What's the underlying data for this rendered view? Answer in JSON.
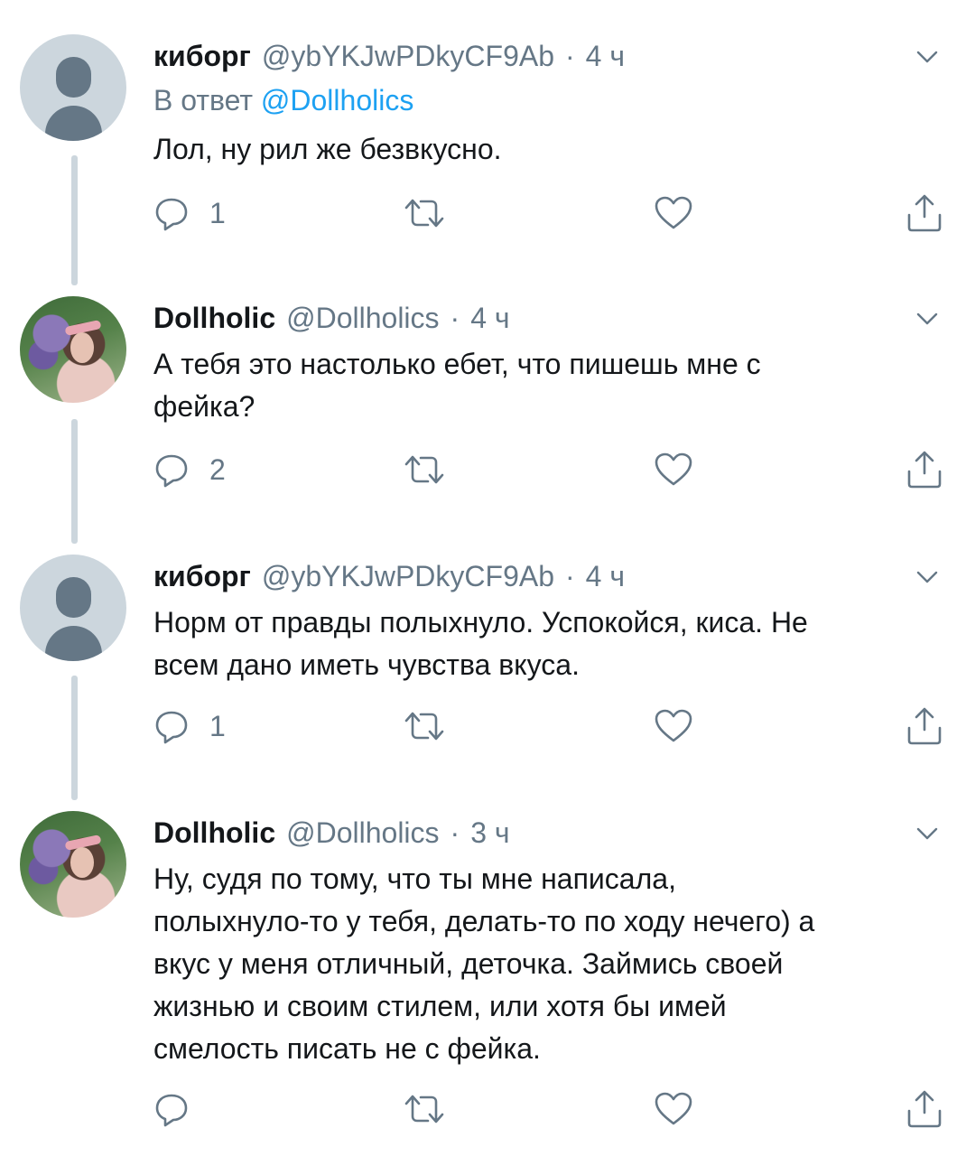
{
  "colors": {
    "accent": "#1da1f2",
    "text": "#14171a",
    "muted": "#657786",
    "thread_line": "#ccd6dd"
  },
  "tweets": [
    {
      "name": "киборг",
      "handle": "@ybYKJwPDkyCF9Ab",
      "dot": "·",
      "time": "4 ч",
      "reply_prefix": "В ответ",
      "reply_mention": "@Dollholics",
      "lines": [
        "Лол, ну рил же безвкусно."
      ],
      "reply_count": "1",
      "avatar": "default-avatar-icon"
    },
    {
      "name": "Dollholic",
      "handle": "@Dollholics",
      "dot": "·",
      "time": "4 ч",
      "lines": [
        "А тебя это настолько ебет, что пишешь мне с",
        "фейка?"
      ],
      "reply_count": "2",
      "avatar": "profile-photo"
    },
    {
      "name": "киборг",
      "handle": "@ybYKJwPDkyCF9Ab",
      "dot": "·",
      "time": "4 ч",
      "lines": [
        "Норм от правды полыхнуло. Успокойся, киса. Не",
        "всем дано иметь чувства вкуса."
      ],
      "reply_count": "1",
      "avatar": "default-avatar-icon"
    },
    {
      "name": "Dollholic",
      "handle": "@Dollholics",
      "dot": "·",
      "time": "3 ч",
      "lines": [
        "Ну, судя по тому, что ты мне написала,",
        "полыхнуло-то у тебя, делать-то по ходу нечего) а",
        "вкус у меня отличный, деточка. Займись своей",
        "жизнью и своим стилем, или хотя бы имей",
        "смелость писать не с фейка."
      ],
      "reply_count": "",
      "avatar": "profile-photo"
    }
  ],
  "icons": {
    "reply": "reply-icon",
    "retweet": "retweet-icon",
    "like": "heart-icon",
    "share": "share-icon",
    "more": "chevron-down-icon"
  }
}
